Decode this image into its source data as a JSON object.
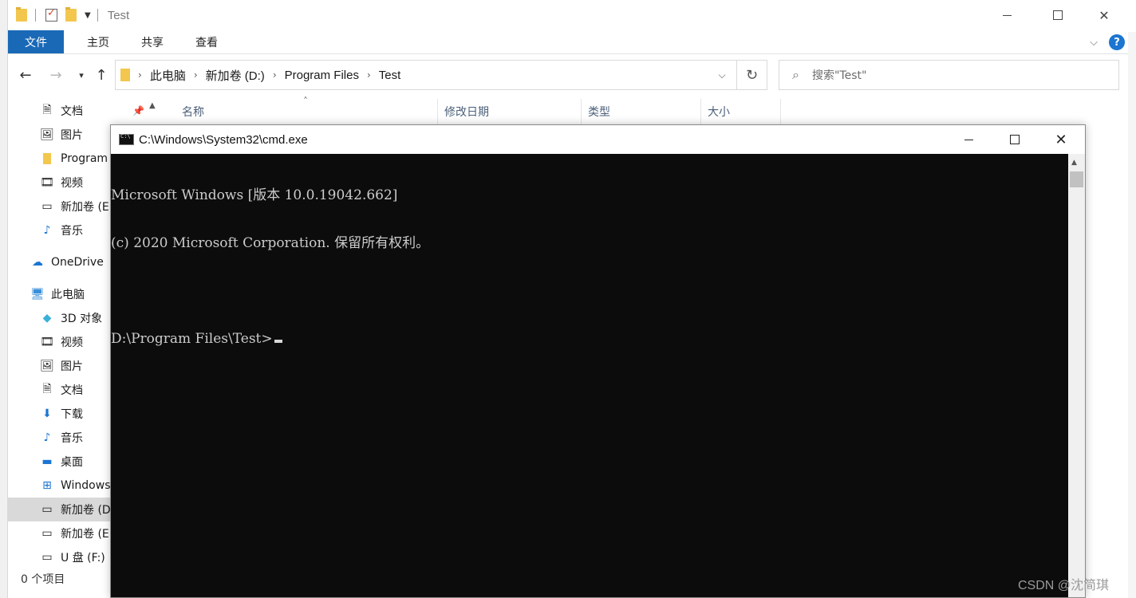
{
  "explorer": {
    "title": "Test",
    "ribbon_tabs": [
      "文件",
      "主页",
      "共享",
      "查看"
    ],
    "help_label": "?",
    "address": {
      "crumbs": [
        "此电脑",
        "新加卷 (D:)",
        "Program Files",
        "Test"
      ]
    },
    "search_placeholder": "搜索\"Test\"",
    "columns": [
      "名称",
      "修改日期",
      "类型",
      "大小"
    ],
    "nav_items": [
      {
        "label": "文档",
        "icon": "document-icon"
      },
      {
        "label": "图片",
        "icon": "pictures-icon"
      },
      {
        "label": "Program",
        "icon": "folder-icon"
      },
      {
        "label": "视频",
        "icon": "video-icon"
      },
      {
        "label": "新加卷 (E",
        "icon": "drive-icon"
      },
      {
        "label": "音乐",
        "icon": "music-icon"
      },
      {
        "label": "OneDrive",
        "icon": "onedrive-icon"
      },
      {
        "label": "此电脑",
        "icon": "computer-icon"
      },
      {
        "label": "3D 对象",
        "icon": "3d-objects-icon"
      },
      {
        "label": "视频",
        "icon": "video-icon"
      },
      {
        "label": "图片",
        "icon": "pictures-icon"
      },
      {
        "label": "文档",
        "icon": "document-icon"
      },
      {
        "label": "下载",
        "icon": "download-icon"
      },
      {
        "label": "音乐",
        "icon": "music-icon"
      },
      {
        "label": "桌面",
        "icon": "desktop-icon"
      },
      {
        "label": "Windows",
        "icon": "windows-drive-icon"
      },
      {
        "label": "新加卷 (D",
        "icon": "drive-icon"
      },
      {
        "label": "新加卷 (E:",
        "icon": "drive-icon"
      },
      {
        "label": "U 盘 (F:)",
        "icon": "usb-drive-icon"
      }
    ],
    "status": "0 个项目"
  },
  "cmd": {
    "title": "C:\\Windows\\System32\\cmd.exe",
    "lines": [
      "Microsoft Windows [版本 10.0.19042.662]",
      "(c) 2020 Microsoft Corporation. 保留所有权利。",
      "",
      "D:\\Program Files\\Test>"
    ]
  },
  "watermark": "CSDN @沈简琪",
  "colors": {
    "file_tab": "#1a69b7",
    "console_bg": "#0c0c0c",
    "console_text": "#cccccc",
    "selected_nav": "#d9d9d9"
  }
}
